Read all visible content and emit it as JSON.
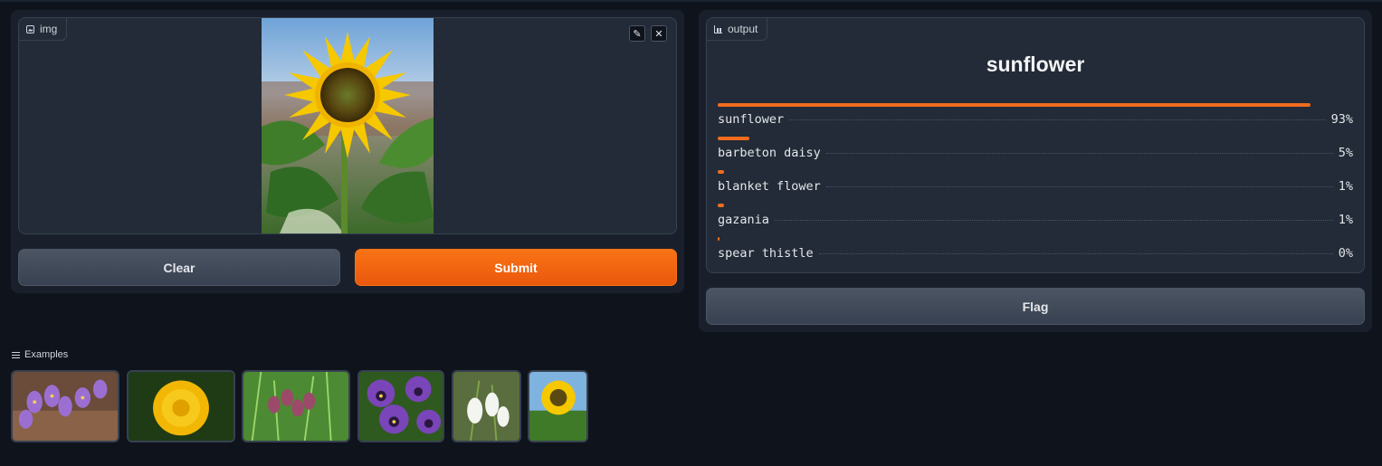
{
  "input": {
    "label": "img",
    "icon": "image-icon"
  },
  "buttons": {
    "clear": "Clear",
    "submit": "Submit",
    "flag": "Flag"
  },
  "output": {
    "label": "output",
    "icon": "chart-icon",
    "top_label": "sunflower",
    "confidences": [
      {
        "label": "sunflower",
        "percent": "93%",
        "value": 0.93
      },
      {
        "label": "barbeton daisy",
        "percent": "5%",
        "value": 0.05
      },
      {
        "label": "blanket flower",
        "percent": "1%",
        "value": 0.01
      },
      {
        "label": "gazania",
        "percent": "1%",
        "value": 0.01
      },
      {
        "label": "spear thistle",
        "percent": "0%",
        "value": 0.0
      }
    ]
  },
  "examples": {
    "label": "Examples",
    "items": [
      "crocus",
      "dandelion",
      "fritillary",
      "pansy",
      "snowdrop",
      "sunflower"
    ]
  },
  "colors": {
    "accent": "#f97316",
    "bar": "#f26c1f",
    "background": "#0f131c",
    "panel": "#1a202b"
  }
}
